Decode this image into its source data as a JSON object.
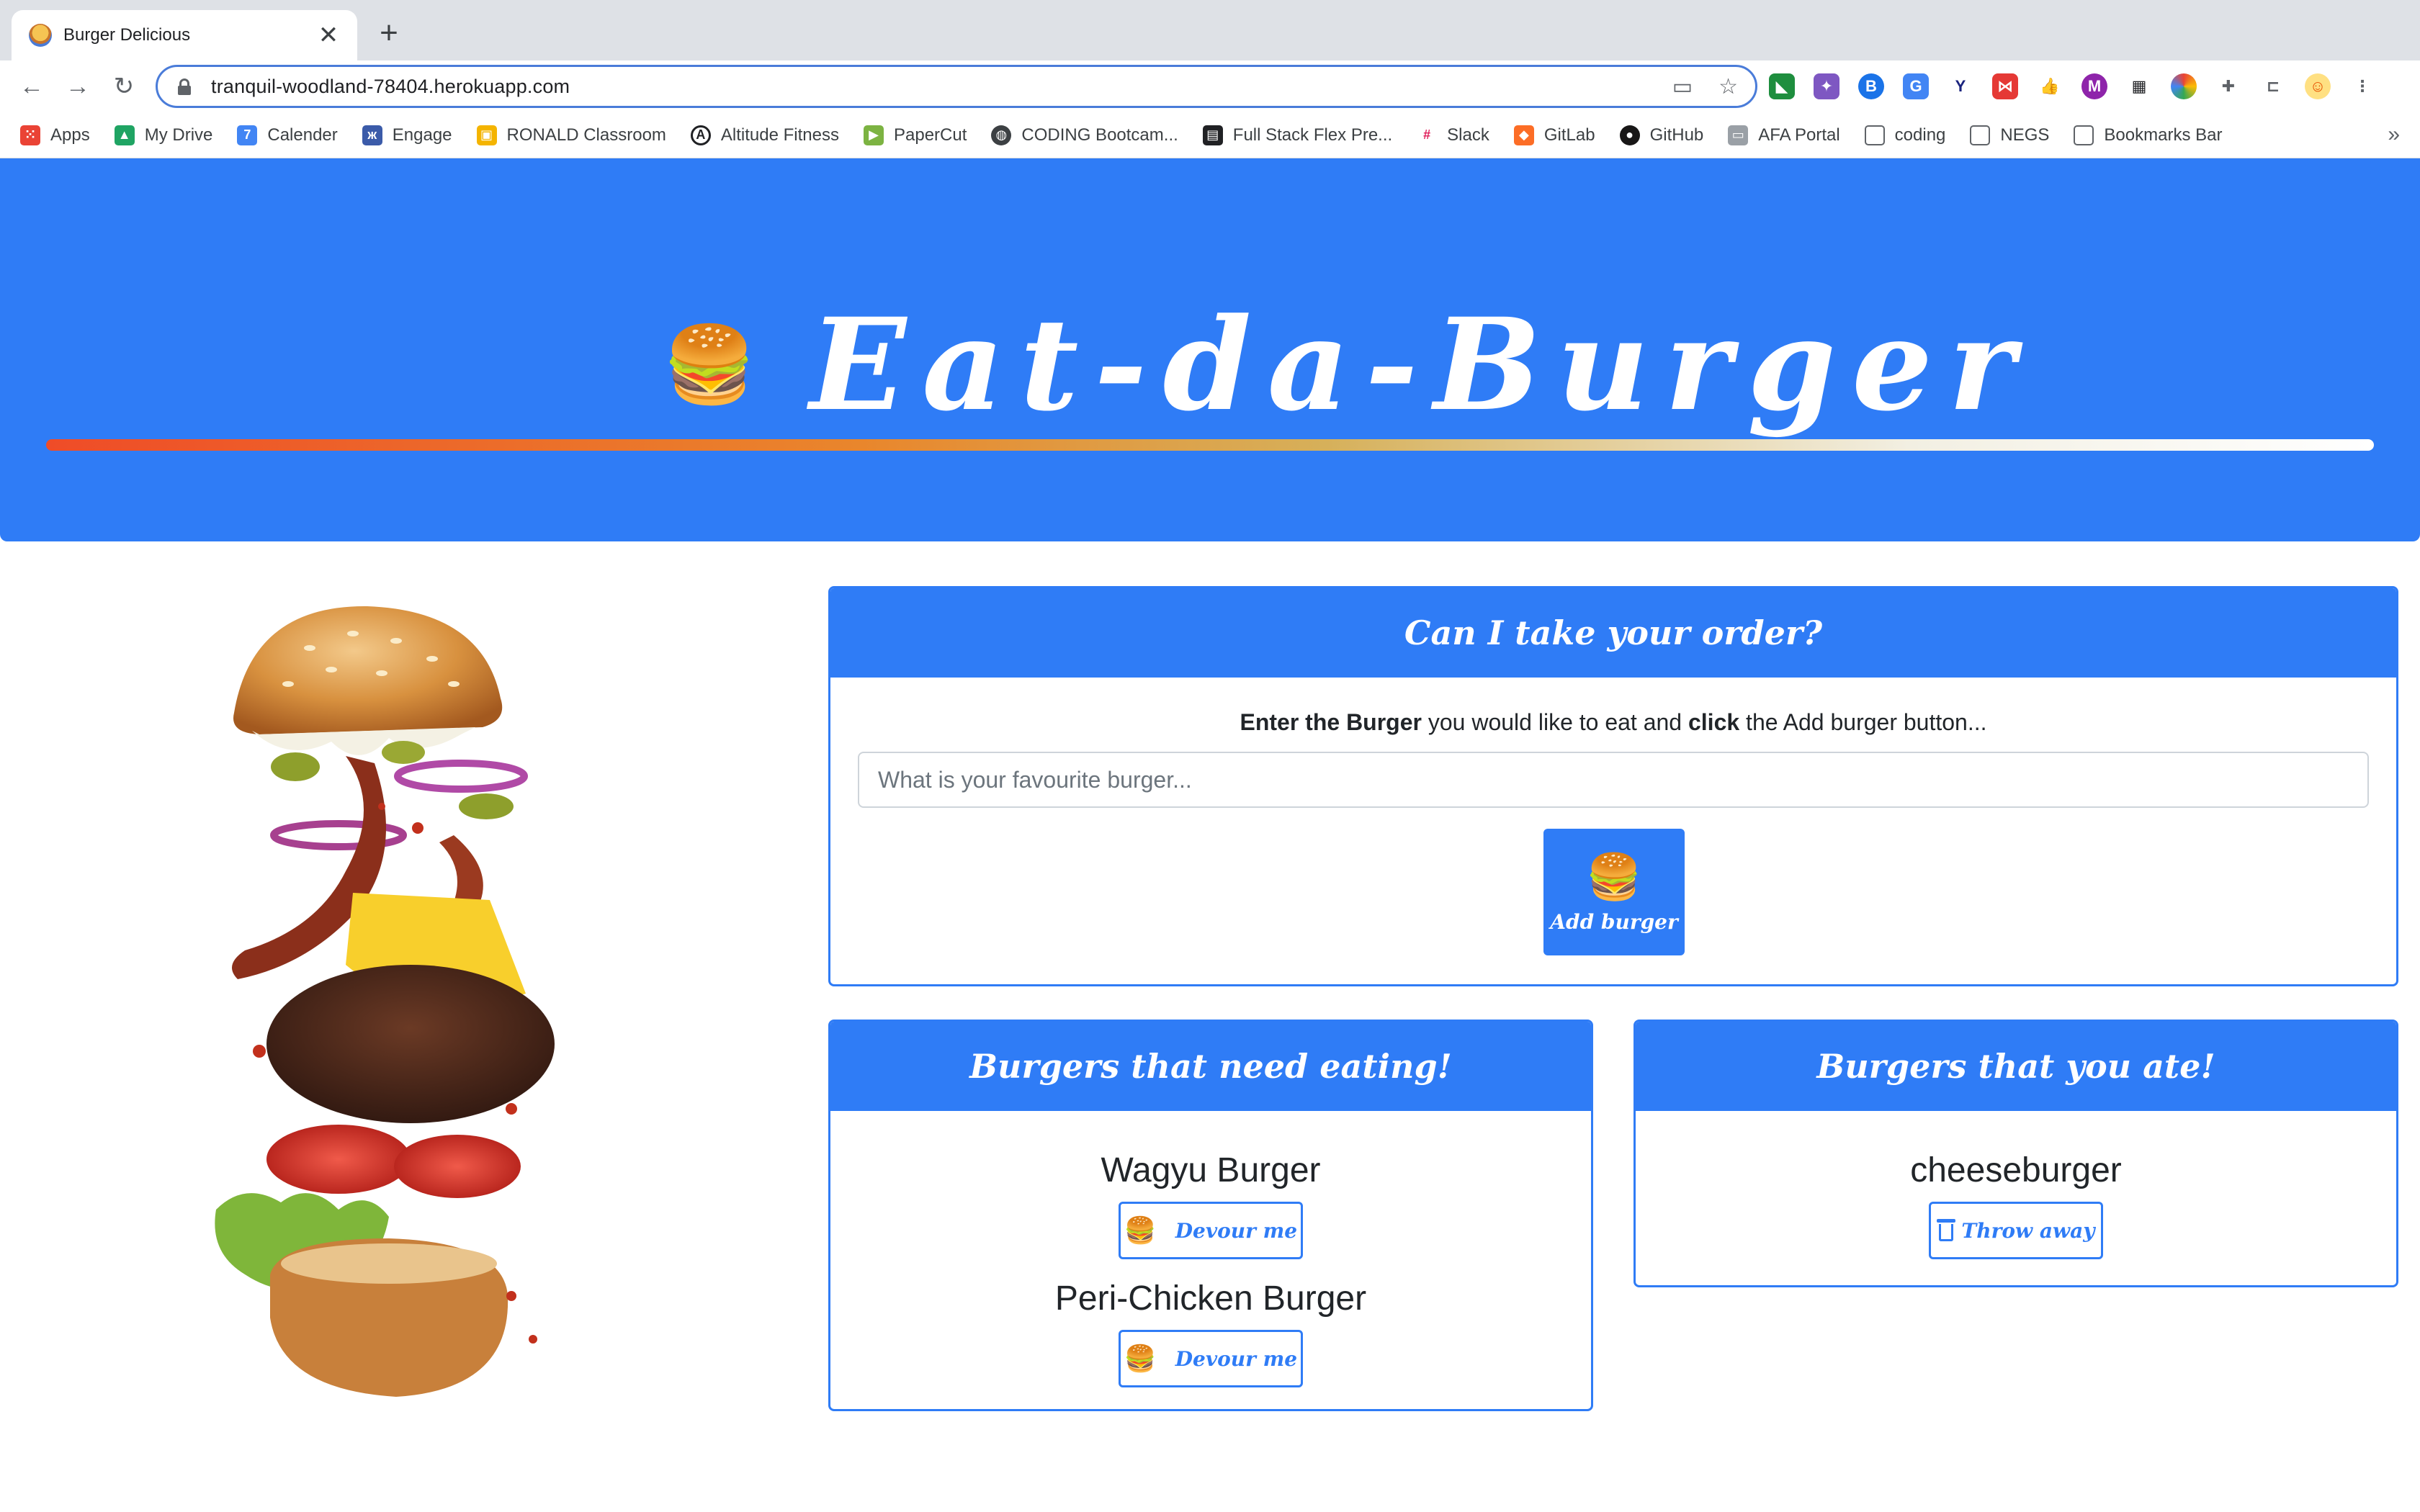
{
  "browser": {
    "tab_title": "Burger Delicious",
    "url": "tranquil-woodland-78404.herokuapp.com",
    "new_tab": "+",
    "close_tab": "✕",
    "bookmarks": [
      {
        "label": "Apps",
        "icon": "apps-grid-icon",
        "color": "#ea4335"
      },
      {
        "label": "My Drive",
        "icon": "google-drive-icon",
        "color": "#1fa463"
      },
      {
        "label": "Calender",
        "icon": "calendar-icon",
        "color": "#4285f4"
      },
      {
        "label": "Engage",
        "icon": "butterfly-icon",
        "color": "#3b5ba9"
      },
      {
        "label": "RONALD Classroom",
        "icon": "classroom-icon",
        "color": "#f4b400"
      },
      {
        "label": "Altitude Fitness",
        "icon": "fitness-icon",
        "color": "#202124"
      },
      {
        "label": "PaperCut",
        "icon": "papercut-icon",
        "color": "#7cb342"
      },
      {
        "label": "CODING Bootcam...",
        "icon": "globe-icon",
        "color": "#3c4043"
      },
      {
        "label": "Full Stack Flex Pre...",
        "icon": "notebook-icon",
        "color": "#202124"
      },
      {
        "label": "Slack",
        "icon": "slack-icon",
        "color": "#611f69"
      },
      {
        "label": "GitLab",
        "icon": "gitlab-icon",
        "color": "#fc6d26"
      },
      {
        "label": "GitHub",
        "icon": "github-icon",
        "color": "#181717"
      },
      {
        "label": "AFA Portal",
        "icon": "portal-icon",
        "color": "#9aa0a6"
      },
      {
        "label": "coding",
        "icon": "folder-icon",
        "color": "#5f6368"
      },
      {
        "label": "NEGS",
        "icon": "folder-icon",
        "color": "#5f6368"
      },
      {
        "label": "Bookmarks Bar",
        "icon": "folder-icon",
        "color": "#5f6368"
      }
    ],
    "bookmarks_more": "»"
  },
  "hero": {
    "emoji": "🍔",
    "title": "Eat-da-Burger",
    "accent_color": "#2f7cf6"
  },
  "order": {
    "header": "Can I take your order?",
    "prompt_bold_1": "Enter the Burger",
    "prompt_mid": " you would like to eat and ",
    "prompt_bold_2": "click",
    "prompt_end": " the Add burger button...",
    "input_placeholder": "What is your favourite burger...",
    "input_value": "",
    "button_emoji": "🍔",
    "button_label": "Add burger"
  },
  "need_eating": {
    "header": "Burgers that need eating!",
    "items": [
      {
        "name": "Wagyu Burger",
        "button_emoji": "🍔",
        "button_label": "Devour me"
      },
      {
        "name": "Peri-Chicken Burger",
        "button_emoji": "🍔",
        "button_label": "Devour me"
      }
    ]
  },
  "eaten": {
    "header": "Burgers that you ate!",
    "items": [
      {
        "name": "cheeseburger",
        "button_icon": "trash-icon",
        "button_label": "Throw away"
      }
    ]
  }
}
